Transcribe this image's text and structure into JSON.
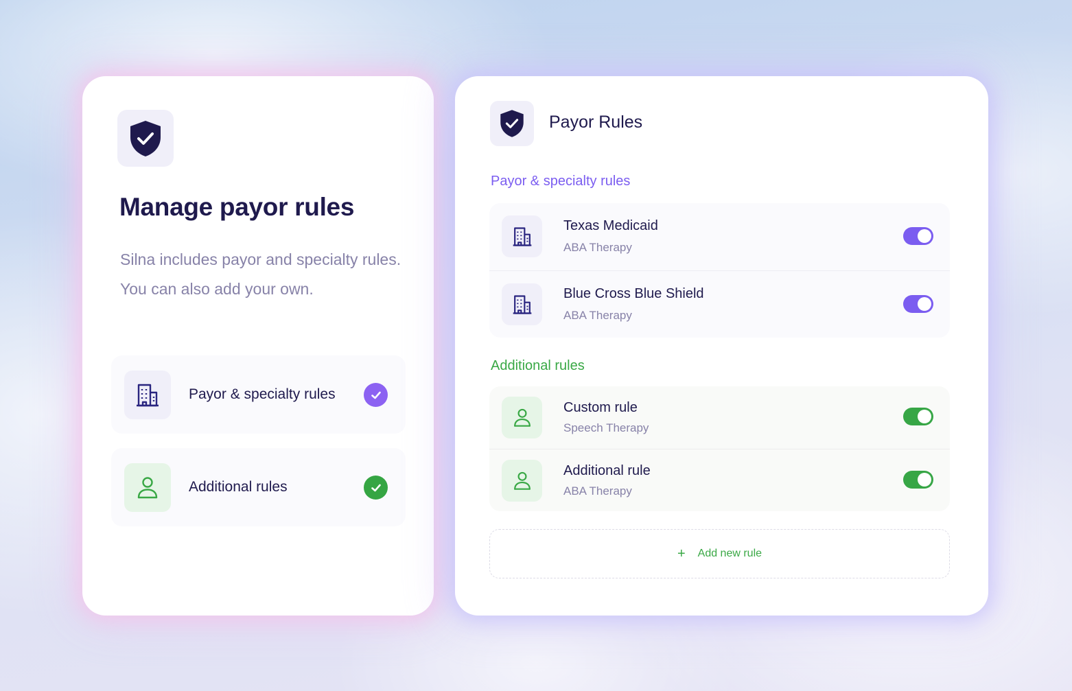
{
  "left_card": {
    "title": "Manage payor rules",
    "description": "Silna includes payor and specialty rules. You can also add your own.",
    "options": [
      {
        "label": "Payor & specialty rules",
        "icon": "building-icon",
        "checked": true,
        "accent": "#8c62f2"
      },
      {
        "label": "Additional rules",
        "icon": "person-icon",
        "checked": true,
        "accent": "#35a543"
      }
    ]
  },
  "right_card": {
    "title": "Payor Rules",
    "sections": [
      {
        "label": "Payor & specialty rules",
        "accent": "#7b5df0",
        "rules": [
          {
            "title": "Texas Medicaid",
            "subtitle": "ABA Therapy",
            "icon": "building-icon",
            "enabled": true
          },
          {
            "title": "Blue Cross Blue Shield",
            "subtitle": "ABA Therapy",
            "icon": "building-icon",
            "enabled": true
          }
        ]
      },
      {
        "label": "Additional rules",
        "accent": "#37a646",
        "rules": [
          {
            "title": "Custom rule",
            "subtitle": "Speech Therapy",
            "icon": "person-icon",
            "enabled": true
          },
          {
            "title": "Additional rule",
            "subtitle": "ABA Therapy",
            "icon": "person-icon",
            "enabled": true
          }
        ]
      }
    ],
    "add_button": {
      "label": "Add new rule",
      "icon": "plus-icon"
    }
  },
  "colors": {
    "navy": "#1f1a4d",
    "purple": "#7b5df0",
    "green": "#37a646",
    "muted_text": "#8782a8"
  }
}
